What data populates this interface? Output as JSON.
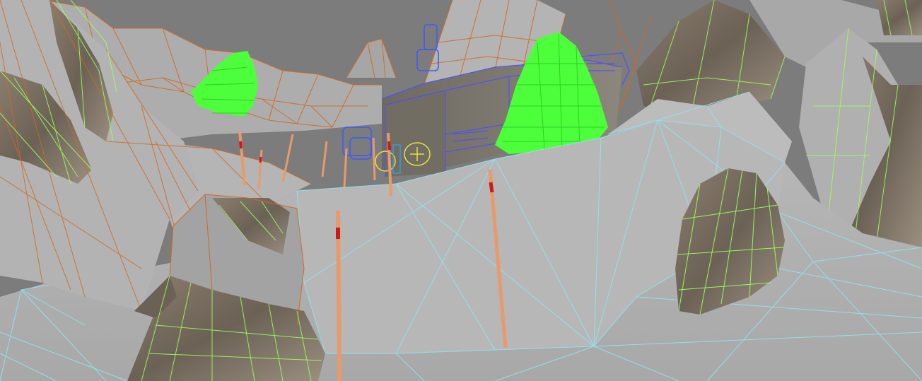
{
  "viewport": {
    "mode": "wireframe-on-shaded",
    "colors": {
      "sky": "#7c7c7c",
      "snow": "#bdbdbd",
      "snow_light": "#cfcfcf",
      "snow_dark": "#9c9c9c",
      "rock": "#7d7265",
      "rock_dark": "#5a5146",
      "terrain_wire": "#8fe3f0",
      "mountain_wire": "#d2691e",
      "rock_wire": "#9bff5a",
      "tree": "#4cff3a",
      "tree_dark": "#2fcf24",
      "building_wire": "#5a5aff",
      "pole": "#e89a6a",
      "pole_marker": "#d01818",
      "gizmo_yellow": "#e8e040",
      "gizmo_blue": "#3a5aff"
    }
  }
}
